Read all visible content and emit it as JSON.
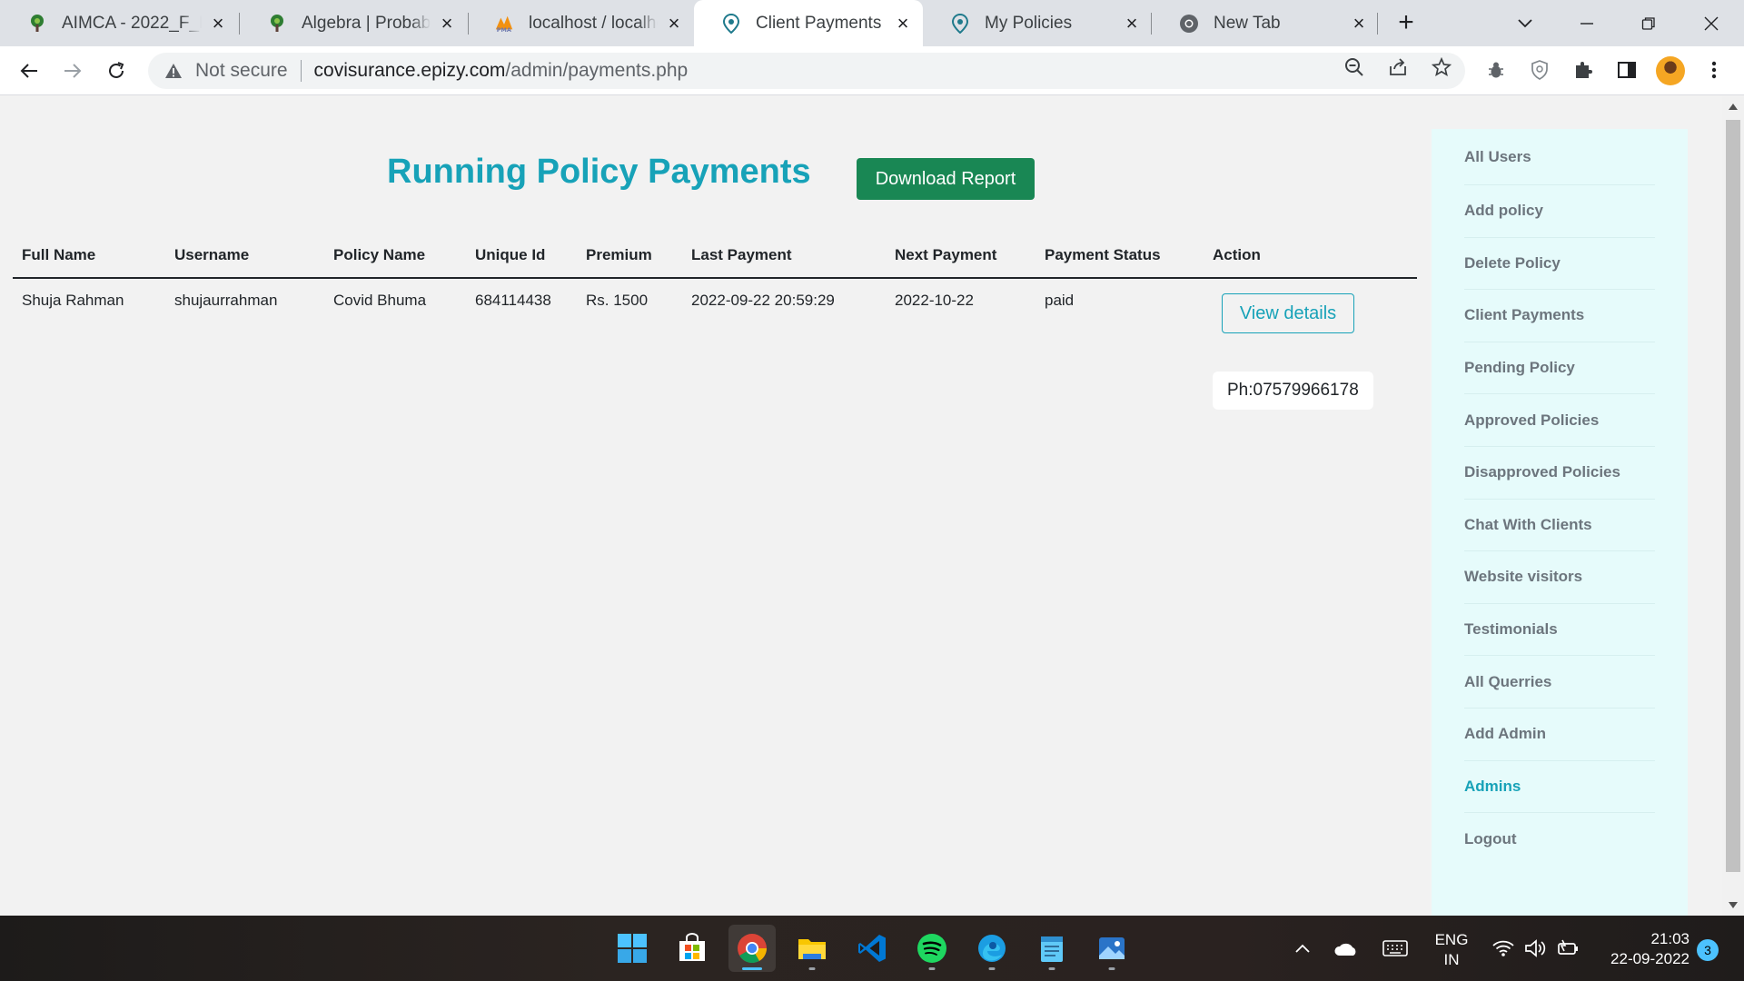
{
  "browser": {
    "tabs": [
      {
        "title": "AIMCA - 2022_F_Ba",
        "icon": "tree-favicon-icon",
        "active": false
      },
      {
        "title": "Algebra | Probabilit",
        "icon": "tree-favicon-icon",
        "active": false
      },
      {
        "title": "localhost / localhos",
        "icon": "phpmyadmin-favicon-icon",
        "active": false
      },
      {
        "title": "Client Payments",
        "icon": "location-pin-favicon-icon",
        "active": true
      },
      {
        "title": "My Policies",
        "icon": "location-pin-favicon-icon",
        "active": false
      },
      {
        "title": "New Tab",
        "icon": "chrome-favicon-icon",
        "active": false
      }
    ],
    "security_label": "Not secure",
    "url_host": "covisurance.epizy.com",
    "url_path": "/admin/payments.php"
  },
  "page": {
    "heading": "Running Policy Payments",
    "download_button": "Download Report",
    "table": {
      "headers": [
        "Full Name",
        "Username",
        "Policy Name",
        "Unique Id",
        "Premium",
        "Last Payment",
        "Next Payment",
        "Payment Status",
        "Action"
      ],
      "rows": [
        {
          "full_name": "Shuja Rahman",
          "username": "shujaurrahman",
          "policy_name": "Covid Bhuma",
          "unique_id": "684114438",
          "premium": "Rs. 1500",
          "last_payment": "2022-09-22 20:59:29",
          "next_payment": "2022-10-22",
          "payment_status": "paid",
          "action_button": "View details",
          "phone": "Ph:07579966178"
        }
      ]
    }
  },
  "sidebar": {
    "items": [
      {
        "label": "All Users"
      },
      {
        "label": "Add policy"
      },
      {
        "label": "Delete Policy"
      },
      {
        "label": "Client Payments"
      },
      {
        "label": "Pending Policy"
      },
      {
        "label": "Approved Policies"
      },
      {
        "label": "Disapproved Policies"
      },
      {
        "label": "Chat With Clients"
      },
      {
        "label": "Website visitors"
      },
      {
        "label": "Testimonials"
      },
      {
        "label": "All Querries"
      },
      {
        "label": "Add Admin"
      },
      {
        "label": "Admins",
        "active": true
      },
      {
        "label": "Logout"
      }
    ]
  },
  "taskbar": {
    "apps": [
      "windows-start-icon",
      "microsoft-store-icon",
      "chrome-icon",
      "file-explorer-icon",
      "vscode-icon",
      "spotify-icon",
      "edge-icon",
      "notepad-icon",
      "photos-icon"
    ],
    "language_line1": "ENG",
    "language_line2": "IN",
    "time": "21:03",
    "date": "22-09-2022",
    "notification_count": "3"
  },
  "colors": {
    "accent": "#17a2b8",
    "download_green": "#198754",
    "sidebar_bg": "#e6fbfb"
  }
}
